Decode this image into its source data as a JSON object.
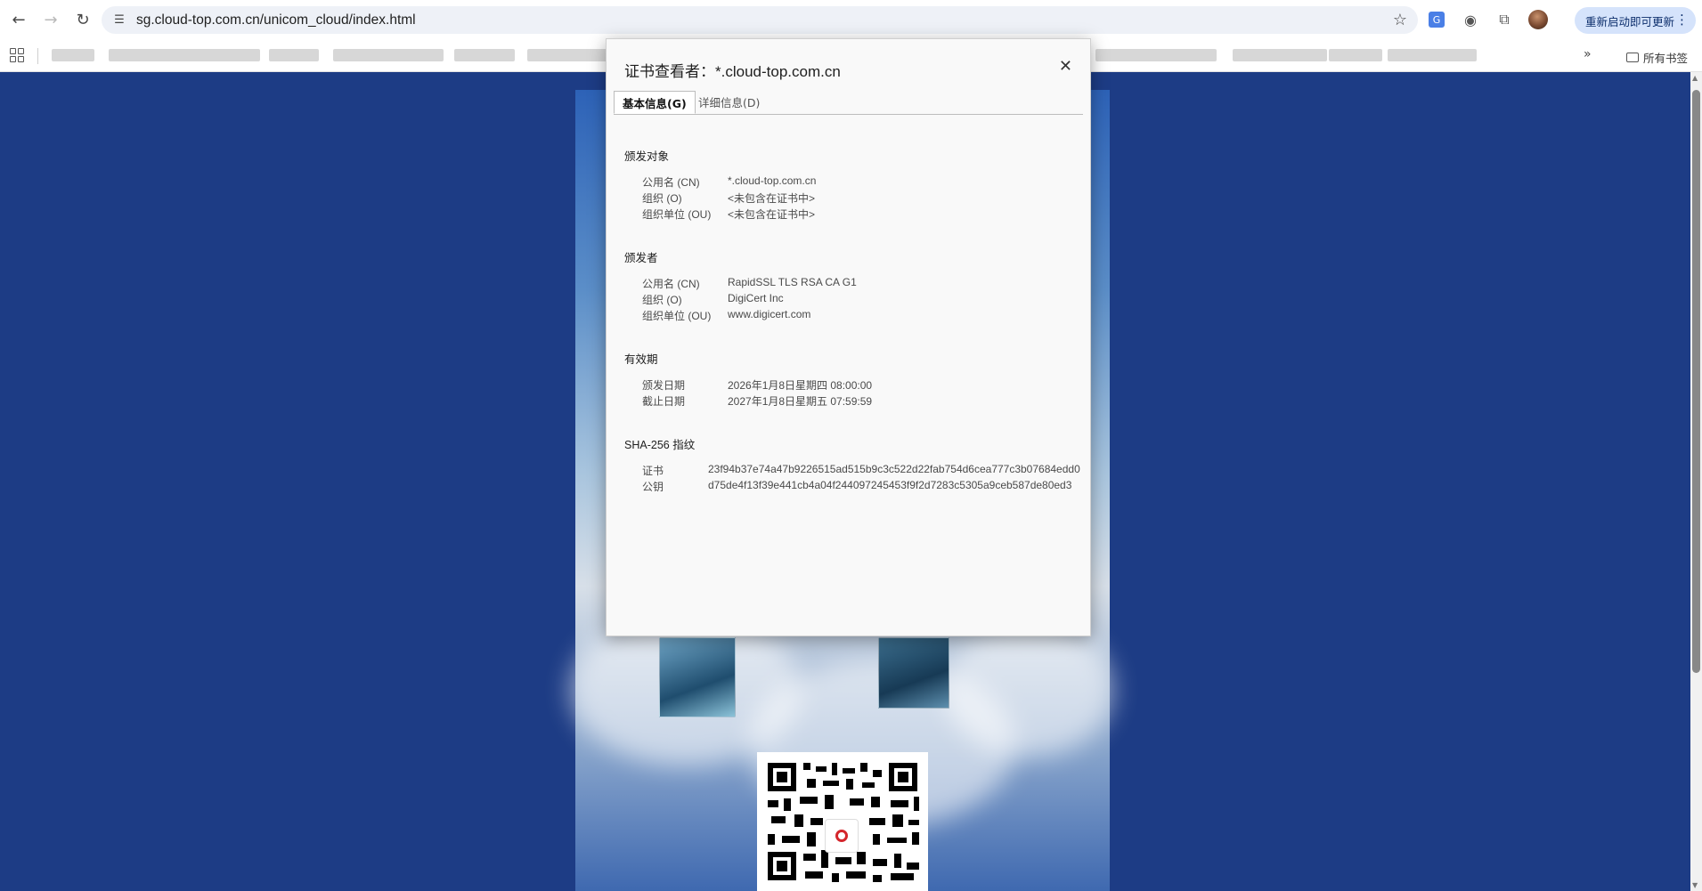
{
  "browser": {
    "url": "sg.cloud-top.com.cn/unicom_cloud/index.html",
    "update_label": "重新启动即可更新",
    "all_bookmarks_label": "所有书签",
    "more_bookmarks_glyph": "»"
  },
  "dialog": {
    "title": "证书查看者：*.cloud-top.com.cn",
    "close_glyph": "✕",
    "tabs": [
      {
        "label": "基本信息(G)",
        "active": true
      },
      {
        "label": "详细信息(D)",
        "active": false
      }
    ],
    "issued_to": {
      "heading": "颁发对象",
      "rows": [
        {
          "key": "公用名 (CN)",
          "value": "*.cloud-top.com.cn"
        },
        {
          "key": "组织 (O)",
          "value": "<未包含在证书中>"
        },
        {
          "key": "组织单位 (OU)",
          "value": "<未包含在证书中>"
        }
      ]
    },
    "issued_by": {
      "heading": "颁发者",
      "rows": [
        {
          "key": "公用名 (CN)",
          "value": "RapidSSL TLS RSA CA G1"
        },
        {
          "key": "组织 (O)",
          "value": "DigiCert Inc"
        },
        {
          "key": "组织单位 (OU)",
          "value": "www.digicert.com"
        }
      ]
    },
    "validity": {
      "heading": "有效期",
      "rows": [
        {
          "key": "颁发日期",
          "value": "2026年1月8日星期四 08:00:00"
        },
        {
          "key": "截止日期",
          "value": "2027年1月8日星期五 07:59:59"
        }
      ]
    },
    "fingerprints": {
      "heading": "SHA-256 指纹",
      "rows": [
        {
          "key": "证书",
          "value": "23f94b37e74a47b9226515ad515b9c3c522d22fab754d6cea777c3b07684edd0"
        },
        {
          "key": "公钥",
          "value": "d75de4f13f39e441cb4a04f244097245453f9f2d7283c5305a9ceb587de80ed3"
        }
      ]
    }
  },
  "colors": {
    "page_background": "#1d3c85",
    "update_button": "#d5e3fb",
    "qr_logo_red": "#d4262c"
  }
}
